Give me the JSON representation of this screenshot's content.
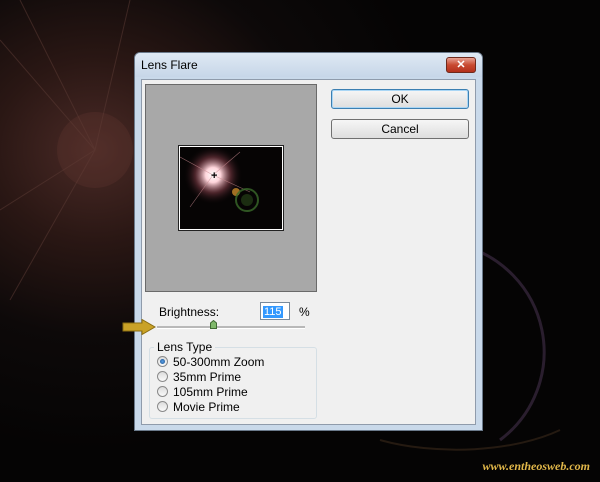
{
  "dialog": {
    "title": "Lens Flare",
    "close_label": "✕"
  },
  "buttons": {
    "ok_label": "OK",
    "cancel_label": "Cancel"
  },
  "brightness": {
    "label": "Brightness:",
    "value": "115",
    "unit": "%",
    "slider_percent": 38
  },
  "lens_type": {
    "legend": "Lens Type",
    "options": [
      {
        "label": "50-300mm Zoom",
        "selected": true
      },
      {
        "label": "35mm Prime",
        "selected": false
      },
      {
        "label": "105mm Prime",
        "selected": false
      },
      {
        "label": "Movie Prime",
        "selected": false
      }
    ]
  },
  "preview": {
    "crosshair_glyph": "+"
  },
  "watermark": "www.entheosweb.com",
  "colors": {
    "accent_blue": "#3399ff",
    "close_red": "#c84a30",
    "arrow_gold": "#c9a227"
  }
}
